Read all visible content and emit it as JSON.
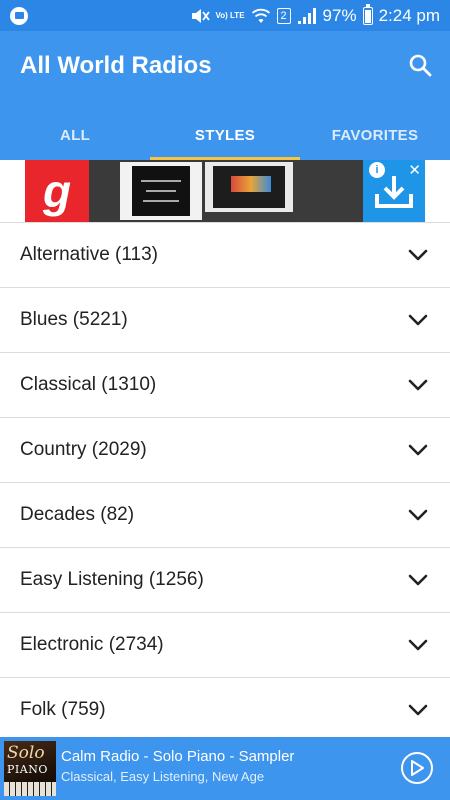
{
  "status_bar": {
    "battery": "97%",
    "time": "2:24 pm",
    "network_label": "Vo) LTE",
    "sim_label": "2",
    "battery_level": 0.97,
    "icons": [
      "notification-icon",
      "mute-icon",
      "volte-icon",
      "wifi-icon",
      "sim-icon",
      "signal-icon",
      "battery-icon"
    ]
  },
  "app_bar": {
    "title": "All World Radios",
    "search_icon": "search-icon"
  },
  "tabs": [
    {
      "label": "ALL",
      "active": false
    },
    {
      "label": "STYLES",
      "active": true
    },
    {
      "label": "FAVORITES",
      "active": false
    }
  ],
  "ad": {
    "logo_letter": "g",
    "info_label": "i",
    "close_label": "✕",
    "icons": [
      "download-icon",
      "info-icon",
      "close-icon"
    ]
  },
  "styles": [
    {
      "label": "Alternative (113)"
    },
    {
      "label": "Blues (5221)"
    },
    {
      "label": "Classical (1310)"
    },
    {
      "label": "Country (2029)"
    },
    {
      "label": "Decades (82)"
    },
    {
      "label": "Easy Listening (1256)"
    },
    {
      "label": "Electronic (2734)"
    },
    {
      "label": "Folk (759)"
    }
  ],
  "player": {
    "title": "Calm Radio - Solo Piano - Sampler",
    "subtitle": "Classical, Easy Listening, New Age",
    "art_text_1": "Solo",
    "art_text_2": "PIANO",
    "play_icon": "play-icon"
  },
  "colors": {
    "primary": "#3d95ee",
    "status_bar": "#2b86e6",
    "tab_indicator": "#f4c542",
    "divider": "#dcdcdc"
  }
}
